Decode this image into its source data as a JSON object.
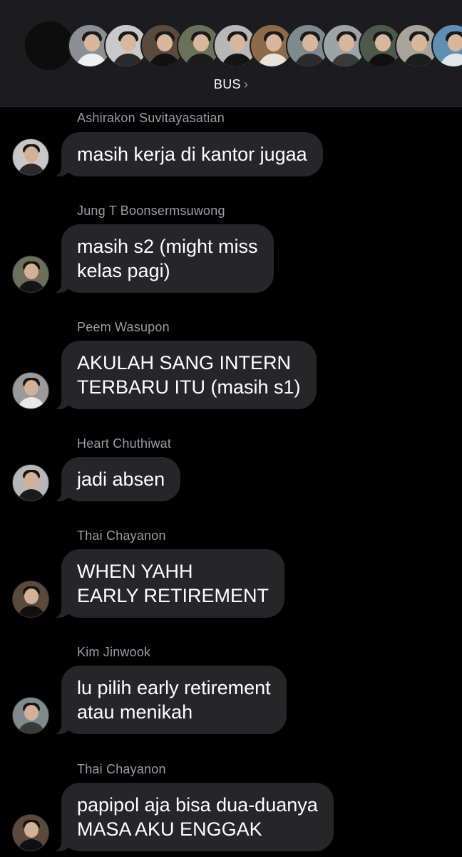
{
  "header": {
    "group_name": "BUS",
    "chevron": "›",
    "member_avatar_icons": [
      "member-avatar-1",
      "member-avatar-2",
      "member-avatar-3",
      "member-avatar-4",
      "member-avatar-5",
      "member-avatar-6",
      "member-avatar-7",
      "member-avatar-8",
      "member-avatar-9",
      "member-avatar-10",
      "member-avatar-11"
    ]
  },
  "messages": [
    {
      "sender": "Ashirakon Suvitayasatian",
      "text": "masih kerja di kantor jugaa"
    },
    {
      "sender": "Jung T Boonsermsuwong",
      "text": "masih s2 (might miss\nkelas pagi)"
    },
    {
      "sender": "Peem Wasupon",
      "text": "AKULAH SANG INTERN\nTERBARU ITU (masih s1)"
    },
    {
      "sender": "Heart Chuthiwat",
      "text": "jadi absen"
    },
    {
      "sender": "Thai Chayanon",
      "text": "WHEN YAHH\nEARLY RETIREMENT"
    },
    {
      "sender": "Kim Jinwook",
      "text": "lu pilih early retirement\natau menikah"
    },
    {
      "sender": "Thai Chayanon",
      "text": "papipol aja bisa dua-duanya\nMASA AKU ENGGAK"
    }
  ],
  "colors": {
    "background": "#000000",
    "header_bg": "#1c1c1e",
    "bubble_bg": "#262628",
    "sender_text": "#9c9ca1",
    "message_text": "#ffffff"
  }
}
